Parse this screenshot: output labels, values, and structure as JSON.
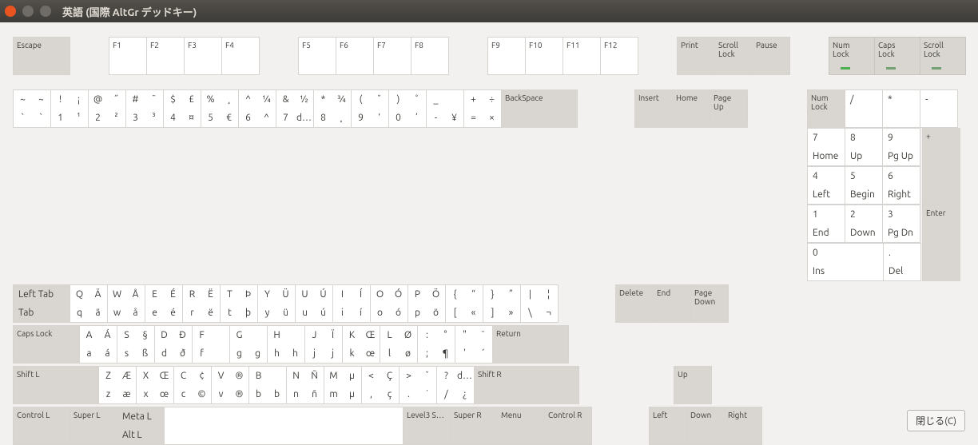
{
  "window": {
    "title": "英語 (国際 AltGr デッドキー)"
  },
  "footer": {
    "close": "閉じる(C)"
  },
  "locks": [
    {
      "label": "Num\nLock",
      "on": true
    },
    {
      "label": "Caps\nLock",
      "on": false
    },
    {
      "label": "Scroll\nLock",
      "on": false
    }
  ],
  "frow": {
    "escape": "Escape",
    "f": [
      "F1",
      "F2",
      "F3",
      "F4",
      "F5",
      "F6",
      "F7",
      "F8",
      "F9",
      "F10",
      "F11",
      "F12"
    ],
    "sys": [
      "Print",
      "Scroll\nLock",
      "Pause"
    ]
  },
  "numrow": {
    "keys": [
      {
        "q": [
          "~",
          "~",
          "`",
          "`"
        ]
      },
      {
        "q": [
          "!",
          "¡",
          "1",
          "¹"
        ]
      },
      {
        "q": [
          "@",
          "˝",
          "2",
          "²"
        ]
      },
      {
        "q": [
          "#",
          "¯",
          "3",
          "³"
        ]
      },
      {
        "q": [
          "$",
          "£",
          "4",
          "¤"
        ]
      },
      {
        "q": [
          "%",
          "¸",
          "5",
          "€"
        ]
      },
      {
        "q": [
          "^",
          "¼",
          "6",
          "^"
        ]
      },
      {
        "q": [
          "&",
          "½",
          "7",
          "d…"
        ]
      },
      {
        "q": [
          "*",
          "¾",
          "8",
          "˛"
        ]
      },
      {
        "q": [
          "(",
          "˘",
          "9",
          "‘"
        ]
      },
      {
        "q": [
          ")",
          "˚",
          "0",
          "’"
        ]
      },
      {
        "q": [
          "_",
          "",
          "-",
          "¥"
        ]
      },
      {
        "q": [
          "+",
          "÷",
          "=",
          "×"
        ]
      }
    ],
    "back": "BackSpace"
  },
  "qrow": {
    "tab": {
      "top": "Left Tab",
      "bot": "Tab"
    },
    "keys": [
      {
        "q": [
          "Q",
          "Ä",
          "q",
          "ä"
        ]
      },
      {
        "q": [
          "W",
          "Å",
          "w",
          "å"
        ]
      },
      {
        "q": [
          "E",
          "É",
          "e",
          "é"
        ]
      },
      {
        "q": [
          "R",
          "Ë",
          "r",
          "ë"
        ]
      },
      {
        "q": [
          "T",
          "Þ",
          "t",
          "þ"
        ]
      },
      {
        "q": [
          "Y",
          "Ü",
          "y",
          "ü"
        ]
      },
      {
        "q": [
          "U",
          "Ú",
          "u",
          "ú"
        ]
      },
      {
        "q": [
          "I",
          "Í",
          "i",
          "í"
        ]
      },
      {
        "q": [
          "O",
          "Ó",
          "o",
          "ó"
        ]
      },
      {
        "q": [
          "P",
          "Ö",
          "p",
          "ö"
        ]
      },
      {
        "q": [
          "{",
          "“",
          "[",
          "«"
        ]
      },
      {
        "q": [
          "}",
          "”",
          "]",
          "»"
        ]
      },
      {
        "q": [
          "|",
          "¦",
          "\\",
          "¬"
        ]
      }
    ]
  },
  "arow": {
    "caps": "Caps Lock",
    "keys": [
      {
        "q": [
          "A",
          "Á",
          "a",
          "á"
        ]
      },
      {
        "q": [
          "S",
          "§",
          "s",
          "ß"
        ]
      },
      {
        "q": [
          "D",
          "Ð",
          "d",
          "ð"
        ]
      },
      {
        "q": [
          "F",
          "",
          "f",
          ""
        ]
      },
      {
        "q": [
          "G",
          "",
          "g",
          "g"
        ]
      },
      {
        "q": [
          "H",
          "",
          "h",
          "h"
        ]
      },
      {
        "q": [
          "J",
          "Ï",
          "j",
          "j"
        ]
      },
      {
        "q": [
          "K",
          "Œ",
          "k",
          "œ"
        ]
      },
      {
        "q": [
          "L",
          "Ø",
          "l",
          "ø"
        ]
      },
      {
        "q": [
          ":",
          "°",
          ";",
          "¶"
        ]
      },
      {
        "q": [
          "\"",
          "¨",
          "'",
          "´"
        ]
      }
    ],
    "ret": "Return"
  },
  "zrow": {
    "lshift": "Shift L",
    "keys": [
      {
        "q": [
          "Z",
          "Æ",
          "z",
          "æ"
        ]
      },
      {
        "q": [
          "X",
          "Œ",
          "x",
          "œ"
        ]
      },
      {
        "q": [
          "C",
          "¢",
          "c",
          "©"
        ]
      },
      {
        "q": [
          "V",
          "®",
          "v",
          "®"
        ]
      },
      {
        "q": [
          "B",
          "",
          "b",
          "b"
        ]
      },
      {
        "q": [
          "N",
          "Ñ",
          "n",
          "ñ"
        ]
      },
      {
        "q": [
          "M",
          "µ",
          "m",
          "µ"
        ]
      },
      {
        "q": [
          "<",
          "Ç",
          ",",
          "ç"
        ]
      },
      {
        "q": [
          ">",
          "ˇ",
          ".",
          "˙"
        ]
      },
      {
        "q": [
          "?",
          "d…",
          "/",
          "¿"
        ]
      }
    ],
    "rshift": "Shift R"
  },
  "botrow": {
    "ctrlL": "Control L",
    "superL": "Super L",
    "meta": {
      "top": "Meta L",
      "bot": "Alt L"
    },
    "level3": "Level3 S…",
    "superR": "Super R",
    "menu": "Menu",
    "ctrlR": "Control R"
  },
  "nav": {
    "r1": [
      "Insert",
      "Home",
      "Page\nUp"
    ],
    "r2": [
      "Delete",
      "End",
      "Page\nDown"
    ],
    "up": "Up",
    "r4": [
      "Left",
      "Down",
      "Right"
    ]
  },
  "numpad": {
    "r1": [
      {
        "l": "Num\nLock",
        "g": true
      },
      {
        "p": [
          "/",
          ""
        ]
      },
      {
        "p": [
          "*",
          ""
        ]
      },
      {
        "p": [
          "-",
          ""
        ]
      }
    ],
    "r2": [
      {
        "p": [
          "7",
          "Home"
        ]
      },
      {
        "p": [
          "8",
          "Up"
        ]
      },
      {
        "p": [
          "9",
          "Pg Up"
        ]
      }
    ],
    "plus": "+",
    "r3": [
      {
        "p": [
          "4",
          "Left"
        ]
      },
      {
        "p": [
          "5",
          "Begin"
        ]
      },
      {
        "p": [
          "6",
          "Right"
        ]
      }
    ],
    "r4": [
      {
        "p": [
          "1",
          "End"
        ]
      },
      {
        "p": [
          "2",
          "Down"
        ]
      },
      {
        "p": [
          "3",
          "Pg Dn"
        ]
      }
    ],
    "enter": "Enter",
    "r5": [
      {
        "p": [
          "0",
          "Ins"
        ],
        "w": "w2"
      },
      {
        "p": [
          ".",
          "Del"
        ]
      }
    ]
  }
}
